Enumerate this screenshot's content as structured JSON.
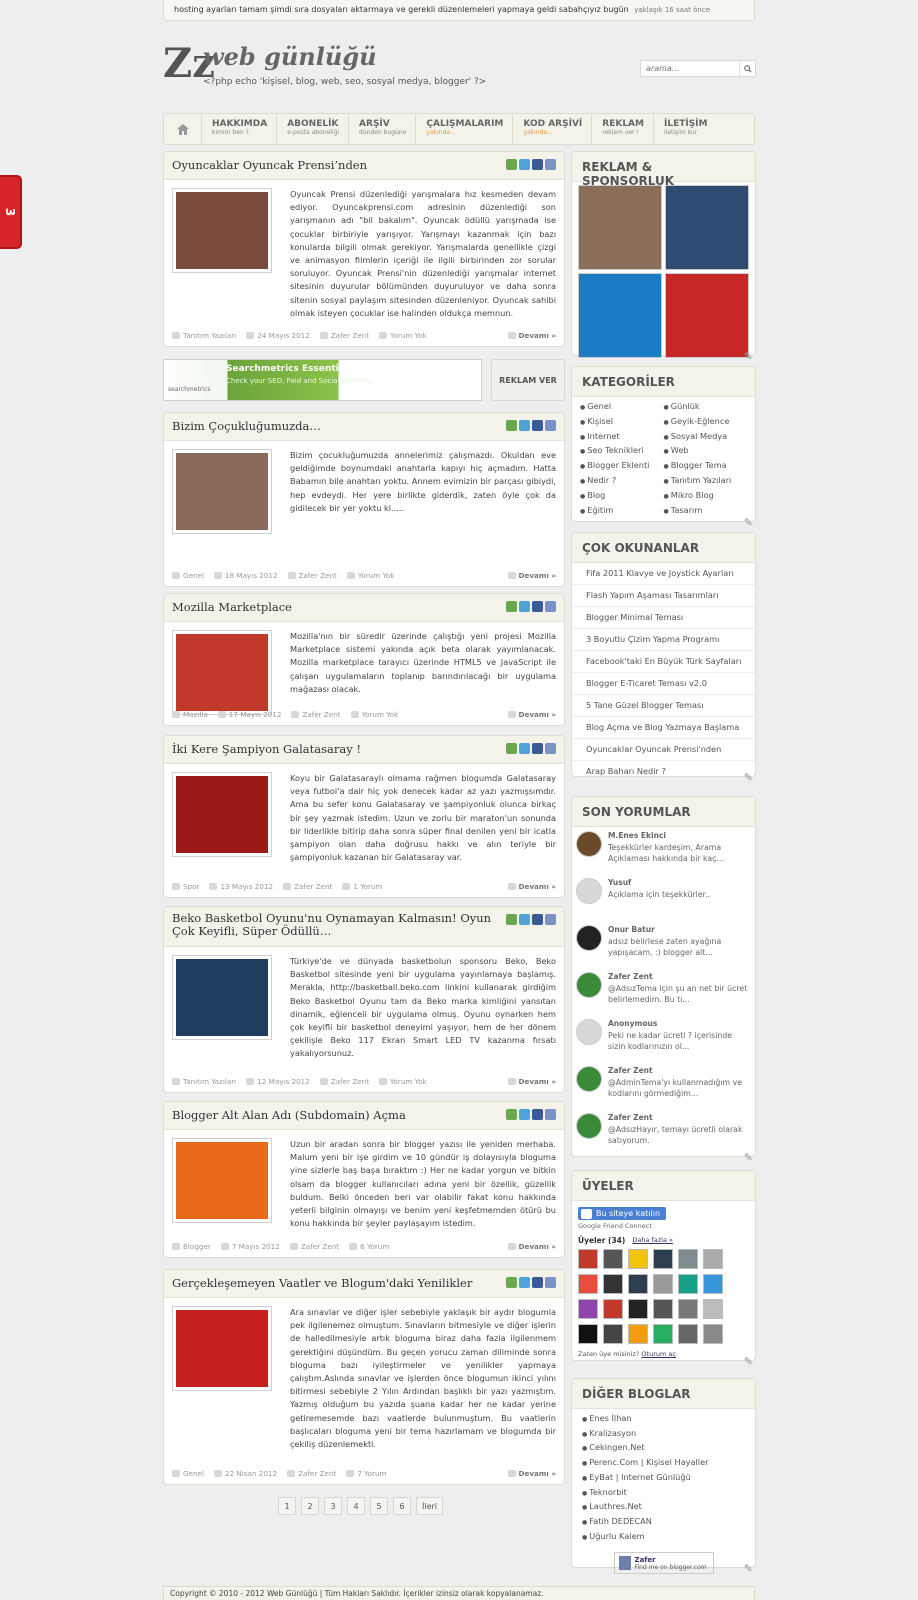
{
  "ticker": {
    "text": "hosting ayarları tamam şimdi sıra dosyaları aktarmaya ve gerekli düzenlemeleri yapmaya geldi sabahçıyız bugün",
    "ago": "yaklaşık 16 saat önce"
  },
  "side_tab": {
    "label": "3"
  },
  "logo": {
    "mark": "Zz",
    "title": "web günlüğü",
    "tagline": "<?php echo 'kişisel, blog, web, seo, sosyal medya, blogger' ?>"
  },
  "search": {
    "placeholder": "arama..."
  },
  "nav": [
    {
      "title": "HAKKIMDA",
      "sub": "kimim ben ?"
    },
    {
      "title": "ABONELİK",
      "sub": "e-posta aboneliği"
    },
    {
      "title": "ARŞİV",
      "sub": "dünden bugüne"
    },
    {
      "title": "ÇALIŞMALARIM",
      "sub": "yakında..."
    },
    {
      "title": "KOD ARŞİVİ",
      "sub": "yakında..."
    },
    {
      "title": "REKLAM",
      "sub": "reklam ver !"
    },
    {
      "title": "İLETİŞİM",
      "sub": "iletişim kur"
    }
  ],
  "posts": [
    {
      "title": "Oyuncaklar Oyuncak Prensi’nden",
      "thumb_color": "#7a4a3a",
      "text": "Oyuncak Prensi düzenlediği yarışmalara hız kesmeden devam ediyor. Oyuncakprensi.com adresinin düzenlediği son yarışmanın adı \"bil bakalım\". Oyuncak ödüllü yarışmada ise çocuklar birbiriyle yarışıyor. Yarışmayı kazanmak için bazı konularda bilgili olmak gerekiyor. Yarışmalarda genellikle çizgi ve animasyon filmlerin içeriği ile ilgili birbirinden zor sorular soruluyor. Oyuncak Prensi'nin düzenlediği yarışmalar internet sitesinin duyurular bölümünden duyuruluyor ve daha sonra sitenin sosyal paylaşım sitesinden düzenleniyor. Oyuncak sahibi olmak isteyen çocuklar ise halinden oldukça memnun.",
      "category": "Tanıtım Yazıları",
      "date": "24 Mayıs 2012",
      "author": "Zafer Zent",
      "comments": "Yorum Yok",
      "more": "Devamı »"
    },
    {
      "title": "Bizim Çoçukluğumuzda…",
      "thumb_color": "#8a6a5a",
      "text": "Bizim çocukluğumuzda annelerimiz çalışmazdı. Okuldan eve geldiğimde boynumdaki anahtarla kapıyı hiç açmadım. Hatta Babamın bile anahtarı yoktu. Annem evimizin bir parçası gibiydi, hep evdeydi. Her yere birlikte giderdik, zaten öyle çok da gidilecek bir yer yoktu ki.....",
      "category": "Genel",
      "date": "18 Mayıs 2012",
      "author": "Zafer Zent",
      "comments": "Yorum Yok",
      "more": "Devamı »"
    },
    {
      "title": "Mozilla Marketplace",
      "thumb_color": "#c0392b",
      "text": "Mozilla'nın bir süredir üzerinde çalıştığı yeni projesi Mozilla Marketplace sistemi yakında açık beta olarak yayımlanacak. Mozilla marketplace tarayıcı üzerinde HTML5 ve JavaScript ile çalışan uygulamaların toplanıp barındırılacağı bir uygulama mağazası olacak.",
      "category": "Mozilla",
      "date": "17 Mayıs 2012",
      "author": "Zafer Zent",
      "comments": "Yorum Yok",
      "more": "Devamı »"
    },
    {
      "title": "İki Kere Şampiyon Galatasaray !",
      "thumb_color": "#9b1b1b",
      "text": "Koyu bir Galatasaraylı olmama rağmen blogumda Galatasaray veya futbol'a dair hiç yok denecek kadar az yazı yazmışsımdır. Ama bu sefer konu Galatasaray ve şampiyonluk olunca birkaç bir şey yazmak istedim. Uzun ve zorlu bir maraton'un sonunda bir liderlikle bitirip daha sonra süper final denilen yeni bir icatla şampiyon olan daha doğrusu hakkı ve alın teriyle bir şampiyonluk kazanan bir Galatasaray var.",
      "category": "Spor",
      "date": "13 Mayıs 2012",
      "author": "Zafer Zent",
      "comments": "1 Yorum",
      "more": "Devamı »"
    },
    {
      "title": "Beko Basketbol Oyunu'nu Oynamayan Kalmasın! Oyun Çok Keyifli, Süper Ödüllü…",
      "thumb_color": "#1f3b5e",
      "text": "Türkiye'de ve dünyada basketbolun sponsoru Beko, Beko Basketbol sitesinde yeni bir uygulama yayınlamaya başlamış. Merakla, http://basketball.beko.com linkini kullanarak girdiğim Beko Basketbol Oyunu tam da Beko marka kimliğini yansıtan dinamik, eğlenceli bir uygulama olmuş. Oyunu oynarken hem çok keyifli bir basketbol deneyimi yaşıyor, hem de her dönem çekilişle Beko 117 Ekran Smart LED TV kazanma fırsatı yakalıyorsunuz.",
      "category": "Tanıtım Yazıları",
      "date": "12 Mayıs 2012",
      "author": "Zafer Zent",
      "comments": "Yorum Yok",
      "more": "Devamı »"
    },
    {
      "title": "Blogger Alt Alan Adı (Subdomain) Açma",
      "thumb_color": "#e86a1a",
      "text": "Uzun bir aradan sonra bir blogger yazısı ile yeniden merhaba. Malum yeni bir işe girdim ve 10 gündür iş dolayısıyla bloguma yine sizlerle baş başa bıraktım :) Her ne kadar yorgun ve bitkin olsam da blogger kullanıcıları adına yeni bir özellik, güzellik buldum. Belki önceden beri var olabilir fakat konu hakkında yeterli bilginin olmayışı ve benim yeni keşfetmemden ötürü bu konu hakkında bir şeyler paylaşayım istedim.",
      "category": "Blogger",
      "date": "7 Mayıs 2012",
      "author": "Zafer Zent",
      "comments": "6 Yorum",
      "more": "Devamı »"
    },
    {
      "title": "Gerçekleşemeyen Vaatler ve Blogum'daki Yenilikler",
      "thumb_color": "#c8201e",
      "text": "Ara sınavlar ve diğer işler sebebiyle yaklaşık bir aydır blogumla pek ilgilenemez olmuştum. Sınavların bitmesiyle ve diğer işlerin de halledilmesiyle artık bloguma biraz daha fazla ilgilenmem gerektiğini düşündüm. Bu geçen yorucu zaman diliminde sonra bloguma bazı iyileştirmeler ve yenilikler yapmaya çalıştım.Aslında sınavlar ve işlerden önce blogumun ikinci yılını bitirmesi sebebiyle 2 Yılın Ardından başlıklı bir yazı yazmıştım. Yazmış olduğum bu yazıda şuana kadar her ne kadar yerine getiremesemde bazı vaatlerde bulunmuştum. Bu vaatlerin başlıcaları bloguma yeni bir tema hazırlamam ve blogumda bir çekiliş düzenlemekti.",
      "category": "Genel",
      "date": "22 Nisan 2012",
      "author": "Zafer Zent",
      "comments": "7 Yorum",
      "more": "Devamı »"
    }
  ],
  "ad": {
    "title": "Searchmetrics Essentials™",
    "sub": "Check your SEO, Paid and Social Visibility.",
    "brand": "searchmetrics",
    "button": "REKLAM VER"
  },
  "widgets": {
    "sponsors_title": "REKLAM & SPONSORLUK",
    "sponsor_colors": [
      "#8a6e5a",
      "#2f4a73",
      "#1a7ac4",
      "#c62828"
    ],
    "categories_title": "KATEGORİLER",
    "categories_left": [
      "Genel",
      "Kişisel",
      "Internet",
      "Seo Teknikleri",
      "Blogger Eklenti",
      "Nedir ?",
      "Blog",
      "Eğitim"
    ],
    "categories_right": [
      "Günlük",
      "Geyik-Eğlence",
      "Sosyal Medya",
      "Web",
      "Blogger Tema",
      "Tanıtım Yazıları",
      "Mikro Blog",
      "Tasarım"
    ],
    "popular_title": "ÇOK OKUNANLAR",
    "popular": [
      "Fifa 2011 Klavye ve Joystick Ayarları",
      "Flash Yapım Aşaması Tasarımları",
      "Blogger Minimal Teması",
      "3 Boyutlu Çizim Yapma Programı",
      "Facebook'taki En Büyük Türk Sayfaları",
      "Blogger E-Ticaret Teması v2.0",
      "5 Tane Güzel Blogger Teması",
      "Blog Açma ve Blog Yazmaya Başlama",
      "Oyuncaklar Oyuncak Prensi'nden",
      "Arap Baharı Nedir ?"
    ],
    "comments_title": "SON YORUMLAR",
    "comments": [
      {
        "name": "M.Enes Ekinci",
        "text": "Teşekkürler kardeşim, Arama Açıklaması hakkında bir kaç...",
        "color": "#6b4a2a"
      },
      {
        "name": "Yusuf",
        "text": "Açıklama için teşekkürler..",
        "color": "#d8d8d8"
      },
      {
        "name": "Onur Batur",
        "text": "adsız belirlese zaten ayağına yapışacam, :) blogger alt...",
        "color": "#222222"
      },
      {
        "name": "Zafer Zent",
        "text": "@AdsızTema için şu an net bir ücret belirlemedim. Bu ti...",
        "color": "#3a8a3a"
      },
      {
        "name": "Anonymous",
        "text": "Peki ne kadar ücreti ? içerisinde sizin kodlarınızın ol...",
        "color": "#d8d8d8"
      },
      {
        "name": "Zafer Zent",
        "text": "@AdminTema'yı kullanmadığım ve kodlarını görmediğim...",
        "color": "#3a8a3a"
      },
      {
        "name": "Zafer Zent",
        "text": "@AdsızHayır, temayı ücretli olarak satıyorum.",
        "color": "#3a8a3a"
      }
    ],
    "members_title": "ÜYELER",
    "gfc_button": "Bu siteye katılın",
    "gfc_sub": "Google Friend Connect",
    "members_label": "Üyeler (34)",
    "members_more": "Daha fazla »",
    "member_colors": [
      "#c0392b",
      "#555",
      "#f1c40f",
      "#2c3e50",
      "#7f8c8d",
      "#aaa",
      "#e74c3c",
      "#333",
      "#2c3e50",
      "#999",
      "#16a085",
      "#3498db",
      "#8e44ad",
      "#c0392b",
      "#222",
      "#555",
      "#777",
      "#bbb",
      "#111",
      "#444",
      "#f39c12",
      "#27ae60",
      "#666",
      "#888"
    ],
    "members_foot": "Zaten üye misiniz?",
    "members_login": "Oturum aç",
    "blogs_title": "DİĞER BLOGLAR",
    "blogs": [
      "Enes İlhan",
      "Kralizasyon",
      "Cekingen.Net",
      "Perenc.Com | Kişisel Hayaller",
      "EyBat | Internet Günlüğü",
      "Teknorbit",
      "Lauthres.Net",
      "Fatih DEDECAN",
      "Uğurlu Kalem"
    ],
    "badge_name": "Zafer",
    "badge_sub": "Find me on blogger.com"
  },
  "pager": [
    "1",
    "2",
    "3",
    "4",
    "5",
    "6",
    "İleri"
  ],
  "footer": "Copyright © 2010 - 2012 Web Günlüğü | Tüm Hakları Saklıdır. İçerikler izinsiz olarak kopyalanamaz."
}
